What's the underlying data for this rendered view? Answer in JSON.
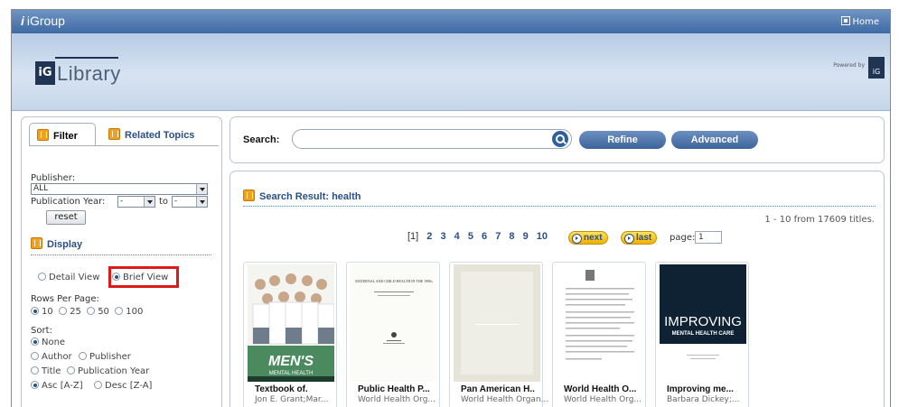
{
  "app": {
    "brand": "iGroup",
    "home_label": "Home"
  },
  "banner": {
    "logo_mark": "iG",
    "logo_text": "Library",
    "powered_by": "Powered by",
    "powered_mark": "iG"
  },
  "sidebar": {
    "tabs": [
      {
        "label": "Filter"
      },
      {
        "label": "Related Topics"
      }
    ],
    "publisher_label": "Publisher:",
    "publisher_value": "ALL",
    "pubyear_label": "Publication Year:",
    "year_from": "-",
    "to_label": "to",
    "year_to": "-",
    "reset_label": "reset",
    "display_label": "Display",
    "view_options": [
      "Detail View",
      "Brief View"
    ],
    "rows_label": "Rows Per Page:",
    "rows_options": [
      "10",
      "25",
      "50",
      "100"
    ],
    "sort_label": "Sort:",
    "sort_options": [
      "None",
      "Author",
      "Publisher",
      "Title",
      "Publication Year"
    ],
    "order_options": [
      "Asc [A-Z]",
      "Desc [Z-A]"
    ]
  },
  "search": {
    "label": "Search:",
    "value": "",
    "refine_label": "Refine",
    "advanced_label": "Advanced"
  },
  "results": {
    "title": "Search Result: health",
    "count": "1 - 10 from 17609 titles.",
    "pages": [
      "[1]",
      "2",
      "3",
      "4",
      "5",
      "6",
      "7",
      "8",
      "9",
      "10"
    ],
    "next_label": "next",
    "last_label": "last",
    "page_label": "page:",
    "page_value": "1",
    "books": [
      {
        "title": "Textbook of.",
        "author": "Jon E. Grant;Mar...",
        "cover_text": "MEN'S",
        "cover_sub": "MENTAL HEALTH"
      },
      {
        "title": "Public Health P...",
        "author": "World Health Org...",
        "cover_text": "MATERNAL AND CHILD HEALTH IN THE 1990s"
      },
      {
        "title": "Pan American H..",
        "author": "World Health Organ..."
      },
      {
        "title": "World Health O...",
        "author": "World Health Org..."
      },
      {
        "title": "Improving me...",
        "author": "Barbara Dickey;...",
        "cover_text": "IMPROVING",
        "cover_sub": "MENTAL HEALTH CARE"
      }
    ]
  },
  "colors": {
    "accent": "#2a4f86",
    "highlight": "#e01818",
    "button_yellow": "#f1b000"
  }
}
